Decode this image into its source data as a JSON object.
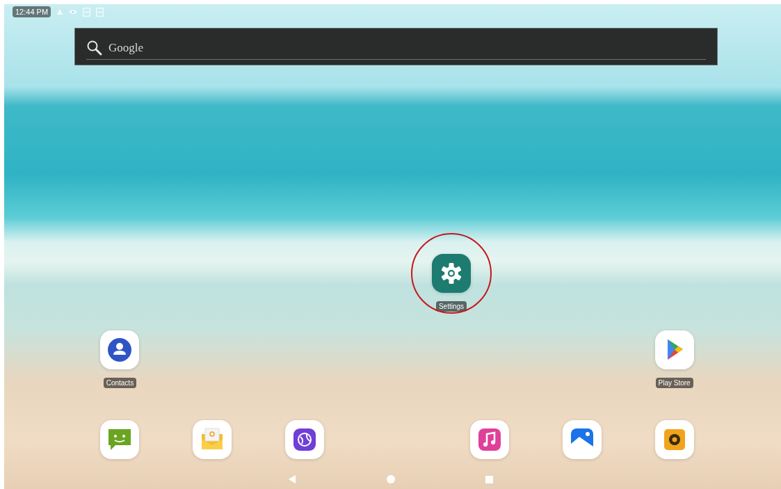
{
  "status_bar": {
    "time": "12:44 PM"
  },
  "search": {
    "placeholder": "Google"
  },
  "featured_app": {
    "label": "Settings",
    "kind": "settings",
    "highlighted": true
  },
  "home_row": [
    {
      "label": "Contacts",
      "kind": "contacts"
    },
    {
      "label": "Play Store",
      "kind": "store"
    }
  ],
  "dock": [
    {
      "kind": "messages"
    },
    {
      "kind": "email"
    },
    {
      "kind": "browser"
    },
    {
      "kind": "music"
    },
    {
      "kind": "gallery"
    },
    {
      "kind": "recorder"
    }
  ]
}
